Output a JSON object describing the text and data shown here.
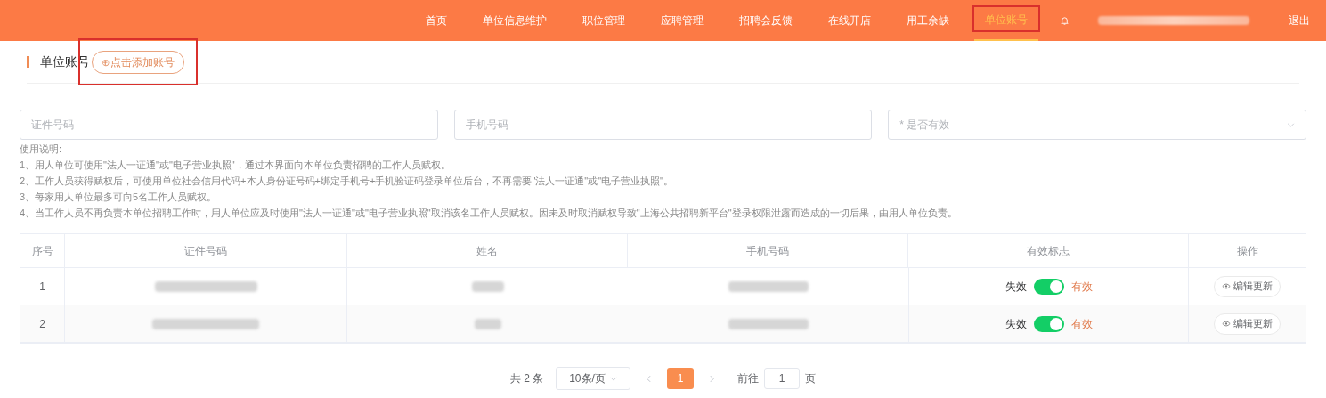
{
  "nav": {
    "items": [
      {
        "label": "首页",
        "selected": false
      },
      {
        "label": "单位信息维护",
        "selected": false
      },
      {
        "label": "职位管理",
        "selected": false
      },
      {
        "label": "应聘管理",
        "selected": false
      },
      {
        "label": "招聘会反馈",
        "selected": false
      },
      {
        "label": "在线开店",
        "selected": false
      },
      {
        "label": "用工余缺",
        "selected": false
      },
      {
        "label": "单位账号",
        "selected": true
      }
    ],
    "logout": "退出"
  },
  "section": {
    "title": "单位账号",
    "add_button": "⊕点击添加账号"
  },
  "filters": [
    {
      "kind": "text",
      "placeholder": "证件号码"
    },
    {
      "kind": "text",
      "placeholder": "手机号码"
    },
    {
      "kind": "select",
      "placeholder": "是否有效",
      "required_mark": "*"
    }
  ],
  "instructions": {
    "heading": "使用说明:",
    "lines": [
      "1、用人单位可使用\"法人一证通\"或\"电子营业执照\"，通过本界面向本单位负责招聘的工作人员赋权。",
      "2、工作人员获得赋权后，可使用单位社会信用代码+本人身份证号码+绑定手机号+手机验证码登录单位后台，不再需要\"法人一证通\"或\"电子营业执照\"。",
      "3、每家用人单位最多可向5名工作人员赋权。",
      "4、当工作人员不再负责本单位招聘工作时，用人单位应及时使用\"法人一证通\"或\"电子营业执照\"取消该名工作人员赋权。因未及时取消赋权导致\"上海公共招聘新平台\"登录权限泄露而造成的一切后果，由用人单位负责。"
    ]
  },
  "table": {
    "columns": [
      "序号",
      "证件号码",
      "姓名",
      "手机号码",
      "有效标志",
      "操作"
    ],
    "rows": [
      {
        "index": "1",
        "off_label": "失效",
        "on_label": "有效",
        "on": true,
        "action": "编辑更新"
      },
      {
        "index": "2",
        "off_label": "失效",
        "on_label": "有效",
        "on": true,
        "action": "编辑更新"
      }
    ]
  },
  "pagination": {
    "total": "共 2 条",
    "page_size": "10条/页",
    "pages": [
      {
        "label": "1",
        "selected": true
      }
    ],
    "goto_label": "前往",
    "goto_value": "1",
    "page_suffix": "页"
  }
}
